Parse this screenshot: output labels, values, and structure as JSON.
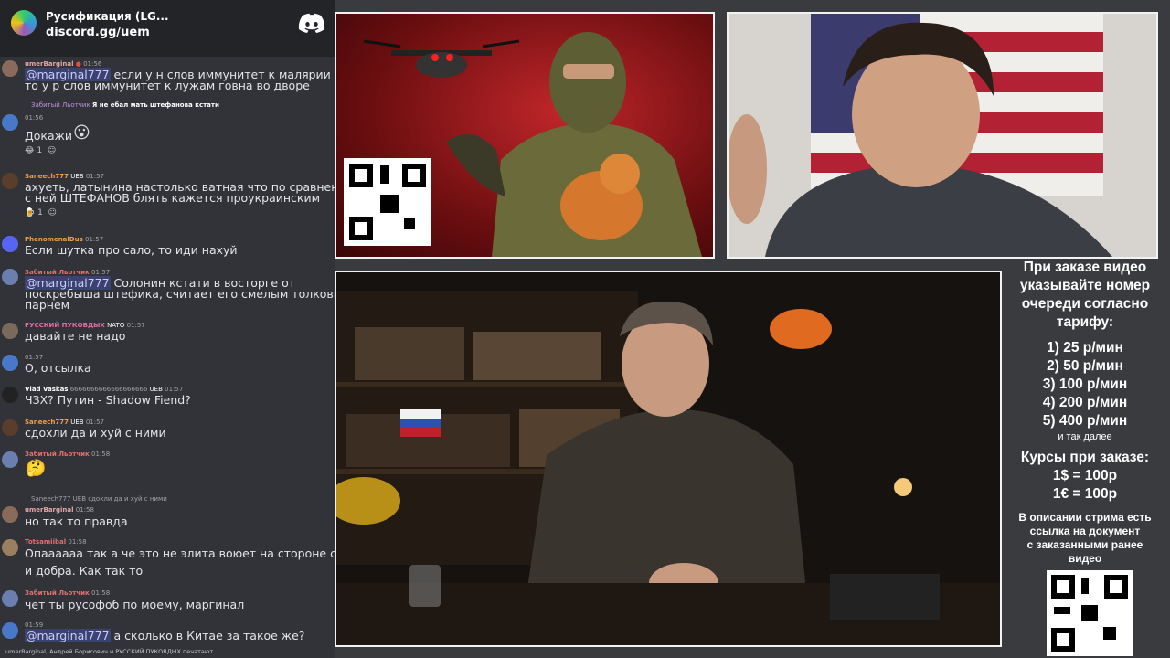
{
  "chat": {
    "server_title": "Русификация (LG...",
    "server_link": "discord.gg/uem",
    "messages": [
      {
        "name": "umerBarginal",
        "time": "01:56",
        "text": "",
        "mention": "@marginal777",
        "rest": " если у н слов иммунитет к малярии",
        "line2": "то у р слов иммунитет к лужам говна во дворе"
      },
      {
        "name": "",
        "time": "01:56",
        "reply": "Я не ебал мать штефанова кстати",
        "text": "Докажи",
        "reaction": "1"
      },
      {
        "name": "Saneech777",
        "badge": "UEB",
        "time": "01:57",
        "text": "ахуеть, латынина настолько ватная что по сравнению",
        "line2": "с ней ШТЕФАНОВ блять кажется проукраинским",
        "reaction": "1"
      },
      {
        "name": "PhenomenalDus",
        "time": "01:57",
        "text": "Если шутка про сало, то иди нахуй"
      },
      {
        "name": "Забитый Льотчик",
        "time": "01:57",
        "text": "",
        "mention": "@marginal777",
        "rest": " Солонин кстати в восторге от",
        "line2": "поскребыша штефика, считает его смелым толковым",
        "line3": "парнем"
      },
      {
        "name": "РУССКИЙ ПУКОВДЫХ",
        "badge": "NATO",
        "time": "01:57",
        "text": "давайте не надо"
      },
      {
        "name": "",
        "time": "01:57",
        "text": "О, отсылка"
      },
      {
        "name": "Vlad Vaskas",
        "extra": "6666666666666666666",
        "badge": "UEB",
        "time": "01:57",
        "text": "ЧЗХ? Путин - Shadow Fiend?"
      },
      {
        "name": "Saneech777",
        "badge": "UEB",
        "time": "01:57",
        "text": "сдохли да и хуй с ними"
      },
      {
        "name": "Забитый Льотчик",
        "time": "01:58",
        "text": ""
      },
      {
        "name": "umerBarginal",
        "time": "01:58",
        "reply": "Saneech777 UEB сдохли да и хуй с ними",
        "text": "но так то правда"
      },
      {
        "name": "Totsamiibal",
        "time": "01:58",
        "text": "Опаааааа так а че это не элита воюет на стороне света",
        "line2": "и добра. Как так то"
      },
      {
        "name": "Забитый Льотчик",
        "time": "01:58",
        "text": "чет ты русофоб по моему, маргинал"
      },
      {
        "name": "",
        "time": "01:59",
        "text": "",
        "mention": "@marginal777",
        "rest": " а сколько в Китае за такое же?"
      }
    ],
    "bottom": "umerBarginal, Андрей Борисович и РУССКИЙ ПУКОВДЫХ печатают..."
  },
  "info": {
    "heading": [
      "При заказе видео",
      "указывайте номер",
      "очереди согласно",
      "тарифу:"
    ],
    "tiers": [
      "1) 25 р/мин",
      "2) 50 р/мин",
      "3) 100 р/мин",
      "4) 200 р/мин",
      "5) 400 р/мин"
    ],
    "etc": "и так далее",
    "rates_heading": "Курсы при заказе:",
    "rates": [
      "1$ = 100р",
      "1€ = 100р"
    ],
    "note": [
      "В описании стрима есть",
      "ссылка на документ",
      "с заказанными ранее",
      "видео"
    ]
  },
  "colors": {
    "chat_bg": "#313338",
    "header_bg": "#232428",
    "mention_bg": "#3c4270",
    "accent": "#5865f2"
  }
}
